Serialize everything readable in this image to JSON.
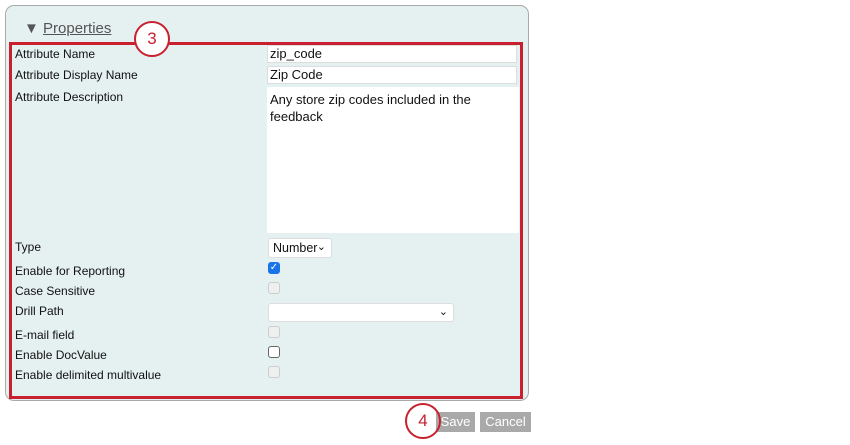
{
  "section": {
    "title": "Properties"
  },
  "callouts": [
    "3",
    "4"
  ],
  "fields": {
    "attribute_name": {
      "label": "Attribute Name",
      "value": "zip_code"
    },
    "display_name": {
      "label": "Attribute Display Name",
      "value": "Zip Code"
    },
    "description": {
      "label": "Attribute Description",
      "value": "Any store zip codes included in the feedback"
    },
    "type": {
      "label": "Type",
      "value": "Number"
    },
    "enable_reporting": {
      "label": "Enable for Reporting",
      "checked": true
    },
    "case_sensitive": {
      "label": "Case Sensitive",
      "checked": false,
      "disabled": true
    },
    "drill_path": {
      "label": "Drill Path",
      "value": ""
    },
    "email_field": {
      "label": "E-mail field",
      "checked": false,
      "disabled": true
    },
    "enable_docvalue": {
      "label": "Enable DocValue",
      "checked": false
    },
    "delimited_multivalue": {
      "label": "Enable delimited multivalue",
      "checked": false,
      "disabled": true
    }
  },
  "buttons": {
    "save": "Save",
    "cancel": "Cancel"
  },
  "colors": {
    "annotation": "#c8202f",
    "checkbox": "#1a73e8"
  }
}
